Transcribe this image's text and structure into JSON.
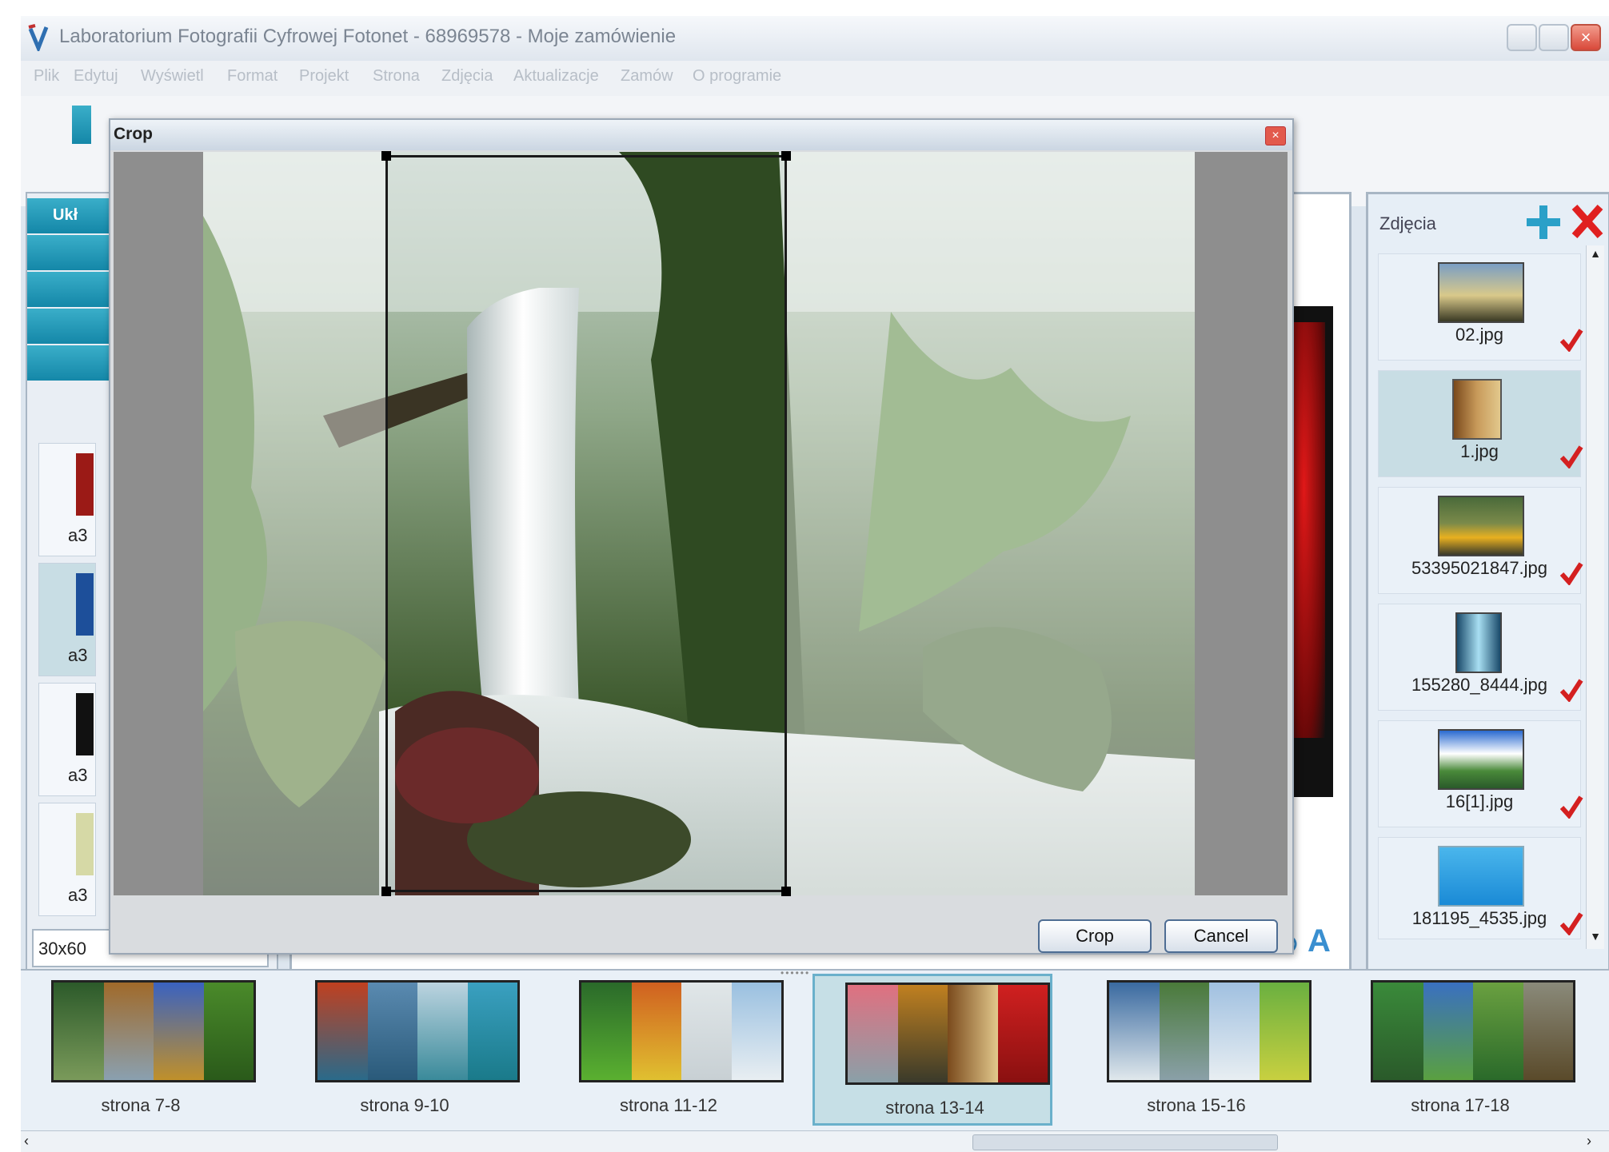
{
  "window": {
    "title": "Laboratorium Fotografii Cyfrowej Fotonet - 68969578 - Moje zamówienie"
  },
  "menu": [
    "Plik",
    "Edytuj",
    "Wyświetl",
    "Format",
    "Projekt",
    "Strona",
    "Zdjęcia",
    "Aktualizacje",
    "Zamów",
    "O programie"
  ],
  "left_panel": {
    "tab_label": "Ukł",
    "thumb_labels": [
      "a3",
      "a3",
      "a3",
      "a3"
    ],
    "size_value": "30x60"
  },
  "photos_panel": {
    "title": "Zdjęcia",
    "items": [
      {
        "name": "02.jpg",
        "checked": true
      },
      {
        "name": "1.jpg",
        "checked": true
      },
      {
        "name": "53395021847.jpg",
        "checked": true
      },
      {
        "name": "155280_8444.jpg",
        "checked": true
      },
      {
        "name": "16[1].jpg",
        "checked": true
      },
      {
        "name": "181195_4535.jpg",
        "checked": true
      }
    ]
  },
  "pages": [
    {
      "label": "strona 7-8",
      "selected": false
    },
    {
      "label": "strona 9-10",
      "selected": false
    },
    {
      "label": "strona 11-12",
      "selected": false
    },
    {
      "label": "strona 13-14",
      "selected": true
    },
    {
      "label": "strona 15-16",
      "selected": false
    },
    {
      "label": "strona 17-18",
      "selected": false
    }
  ],
  "crop_dialog": {
    "title": "Crop",
    "crop_button": "Crop",
    "cancel_button": "Cancel"
  },
  "colors": {
    "accent": "#1487a8",
    "selection": "#c8dde4",
    "check": "#d42020",
    "add": "#2aa0c8",
    "remove": "#e02020"
  }
}
